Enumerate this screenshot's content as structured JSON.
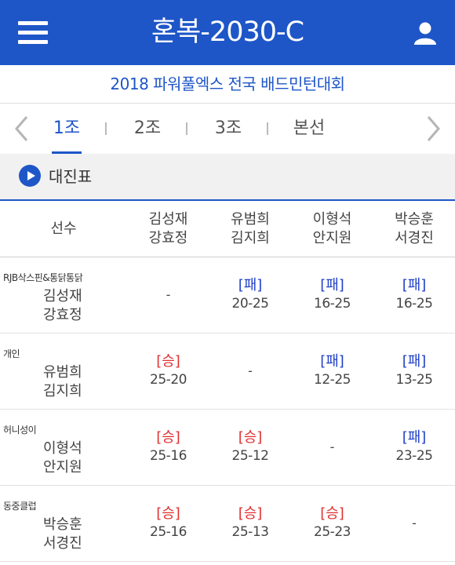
{
  "header": {
    "title": "혼복-2030-C",
    "menu_icon": "hamburger-menu-icon",
    "user_icon": "user-icon"
  },
  "tournament": {
    "name": "2018 파워풀엑스 전국 배드민턴대회"
  },
  "tabs": [
    {
      "label": "1조",
      "active": true
    },
    {
      "label": "2조",
      "active": false
    },
    {
      "label": "3조",
      "active": false
    },
    {
      "label": "본선",
      "active": false
    }
  ],
  "section": {
    "label": "대진표"
  },
  "table": {
    "player_header": "선수",
    "columns": [
      {
        "line1": "김성재",
        "line2": "강효정"
      },
      {
        "line1": "유범희",
        "line2": "김지희"
      },
      {
        "line1": "이형석",
        "line2": "안지원"
      },
      {
        "line1": "박승훈",
        "line2": "서경진"
      }
    ],
    "rows": [
      {
        "club": "RJB삭스핀&통닭통닭",
        "name1": "김성재",
        "name2": "강효정",
        "cells": [
          {
            "result": "",
            "score": "-"
          },
          {
            "result": "[패]",
            "score": "20-25"
          },
          {
            "result": "[패]",
            "score": "16-25"
          },
          {
            "result": "[패]",
            "score": "16-25"
          }
        ]
      },
      {
        "club": "개인",
        "name1": "유범희",
        "name2": "김지희",
        "cells": [
          {
            "result": "[승]",
            "score": "25-20"
          },
          {
            "result": "",
            "score": "-"
          },
          {
            "result": "[패]",
            "score": "12-25"
          },
          {
            "result": "[패]",
            "score": "13-25"
          }
        ]
      },
      {
        "club": "허니성이",
        "name1": "이형석",
        "name2": "안지원",
        "cells": [
          {
            "result": "[승]",
            "score": "25-16"
          },
          {
            "result": "[승]",
            "score": "25-12"
          },
          {
            "result": "",
            "score": "-"
          },
          {
            "result": "[패]",
            "score": "23-25"
          }
        ]
      },
      {
        "club": "동중클럽",
        "name1": "박승훈",
        "name2": "서경진",
        "cells": [
          {
            "result": "[승]",
            "score": "25-16"
          },
          {
            "result": "[승]",
            "score": "25-13"
          },
          {
            "result": "[승]",
            "score": "25-23"
          },
          {
            "result": "",
            "score": "-"
          }
        ]
      }
    ]
  },
  "colors": {
    "brand": "#1e56c8",
    "win": "#e03030",
    "lose": "#2040c8"
  }
}
